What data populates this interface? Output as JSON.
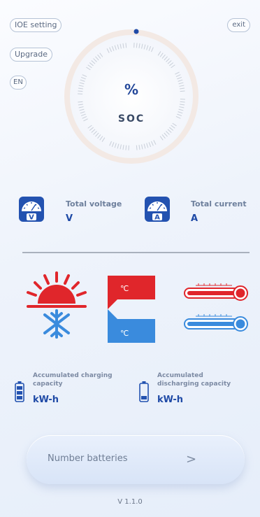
{
  "buttons": {
    "ioe_setting": "IOE setting",
    "upgrade": "Upgrade",
    "language": "EN",
    "exit": "exit"
  },
  "gauge": {
    "percent_symbol": "%",
    "label": "SOC"
  },
  "meters": {
    "voltage": {
      "label": "Total voltage",
      "unit": "V",
      "badge": "V"
    },
    "current": {
      "label": "Total current",
      "unit": "A",
      "badge": "A"
    }
  },
  "temperature": {
    "hot_symbol": "℃",
    "cold_symbol": "℃"
  },
  "capacity": {
    "charging": {
      "label_line1": "Accumulated charging",
      "label_line2": "capacity",
      "unit": "kW-h"
    },
    "discharging": {
      "label_line1": "Accumulated",
      "label_line2": "discharging capacity",
      "unit": "kW-h"
    }
  },
  "number_batteries": {
    "label": "Number batteries",
    "chevron": ">"
  },
  "version": "V 1.1.0",
  "colors": {
    "accent_blue": "#1f4aa6",
    "hot_red": "#e0262b",
    "cold_blue": "#3a8bdd"
  }
}
